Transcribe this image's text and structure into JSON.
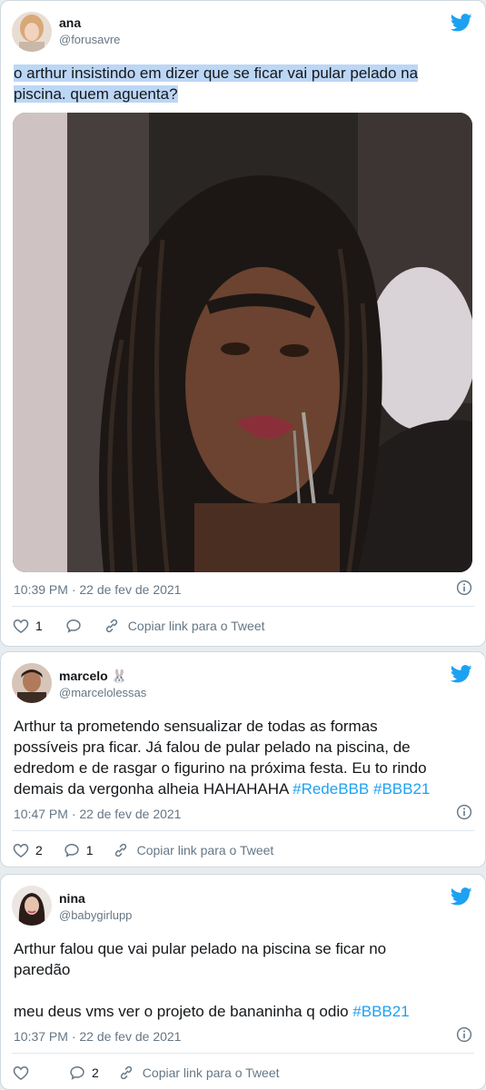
{
  "colors": {
    "accent": "#1da1f2",
    "muted": "#657786",
    "highlight": "#bcd6f5"
  },
  "tweets": [
    {
      "name": "ana",
      "handle": "@forusavre",
      "text_lines": [
        "o arthur insistindo em dizer que se ficar vai pular pelado na",
        "piscina. quem aguenta?"
      ],
      "timestamp": "10:39 PM · 22 de fev de 2021",
      "likes": "1",
      "replies": "",
      "copy_link": "Copiar link para o Tweet",
      "icons": [
        "twitter-bird-icon",
        "info-icon",
        "heart-icon",
        "reply-icon",
        "link-icon"
      ]
    },
    {
      "name": "marcelo",
      "name_emoji": "🐰",
      "handle": "@marcelolessas",
      "text_lines": [
        "Arthur ta prometendo sensualizar de todas as formas",
        "possíveis pra ficar. Já falou de pular pelado na piscina, de",
        "edredom e de rasgar o figurino na próxima festa. Eu to rindo",
        "demais da vergonha alheia HAHAHAHA "
      ],
      "hashtags": [
        "#RedeBBB",
        "#BBB21"
      ],
      "timestamp": "10:47 PM · 22 de fev de 2021",
      "likes": "2",
      "replies": "1",
      "copy_link": "Copiar link para o Tweet"
    },
    {
      "name": "nina",
      "handle": "@babygirlupp",
      "text_lines": [
        "Arthur falou que vai pular pelado na piscina se ficar no",
        "paredão",
        "meu deus vms ver o projeto de bananinha q odio "
      ],
      "hashtags": [
        "#BBB21"
      ],
      "timestamp": "10:37 PM · 22 de fev de 2021",
      "likes": "",
      "replies": "2",
      "copy_link": "Copiar link para o Tweet"
    }
  ]
}
